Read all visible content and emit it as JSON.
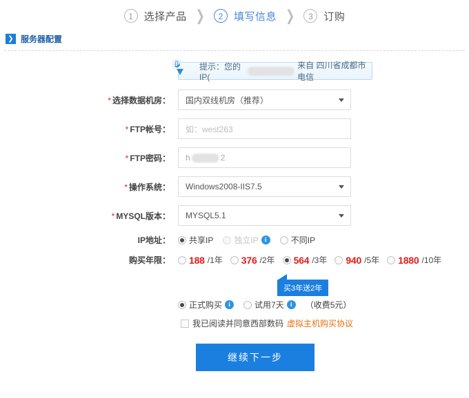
{
  "steps": {
    "separator": "❯",
    "items": [
      {
        "num": "1",
        "label": "选择产品",
        "active": false
      },
      {
        "num": "2",
        "label": "填写信息",
        "active": true
      },
      {
        "num": "3",
        "label": "订购",
        "active": false
      }
    ]
  },
  "section": {
    "arrow_icon": "chevron-right-icon",
    "title": "服务器配置"
  },
  "ip_notice": {
    "icon": "ip-pin-icon",
    "icon_text": "IP",
    "prefix": "提示：您的IP(",
    "redacted_value": "",
    "suffix": "来自 四川省成都市电信"
  },
  "form": {
    "datacenter": {
      "label": "选择数据机房：",
      "required": true,
      "value": "国内双线机房（推荐）"
    },
    "ftp_account": {
      "label": "FTP帐号：",
      "required": true,
      "value": "",
      "placeholder": "如：west263"
    },
    "ftp_password": {
      "label": "FTP密码：",
      "required": true,
      "value_start": "h",
      "value_end": "2"
    },
    "os": {
      "label": "操作系统：",
      "required": true,
      "value": "Windows2008-IIS7.5"
    },
    "mysql": {
      "label": "MYSQL版本：",
      "required": true,
      "value": "MYSQL5.1"
    },
    "ip_address": {
      "label": "IP地址：",
      "required": false,
      "options": [
        {
          "label": "共享IP",
          "selected": true,
          "disabled": false,
          "info": false
        },
        {
          "label": "独立IP",
          "selected": false,
          "disabled": true,
          "info": true
        },
        {
          "label": "不同IP",
          "selected": false,
          "disabled": false,
          "info": false
        }
      ]
    },
    "term": {
      "label": "购买年限：",
      "required": false,
      "options": [
        {
          "price": "188",
          "unit": "/1年",
          "selected": false
        },
        {
          "price": "376",
          "unit": "/2年",
          "selected": false
        },
        {
          "price": "564",
          "unit": "/3年",
          "selected": true
        },
        {
          "price": "940",
          "unit": "/5年",
          "selected": false
        },
        {
          "price": "1880",
          "unit": "/10年",
          "selected": false
        }
      ]
    },
    "promo_tooltip": "买3年送2年",
    "buy_type": {
      "options": [
        {
          "label": "正式购买",
          "selected": true,
          "info": true
        },
        {
          "label": "试用7天",
          "selected": false,
          "info": true
        }
      ],
      "fee_note": "（收费5元）"
    },
    "agreement": {
      "checked": false,
      "text": "我已阅读并同意西部数码",
      "link": "虚拟主机购买协议"
    },
    "submit_label": "继续下一步"
  },
  "colors": {
    "accent": "#1b7fe0",
    "price": "#e21b1b",
    "link": "#e8700f",
    "section_title": "#1c5fa8"
  }
}
